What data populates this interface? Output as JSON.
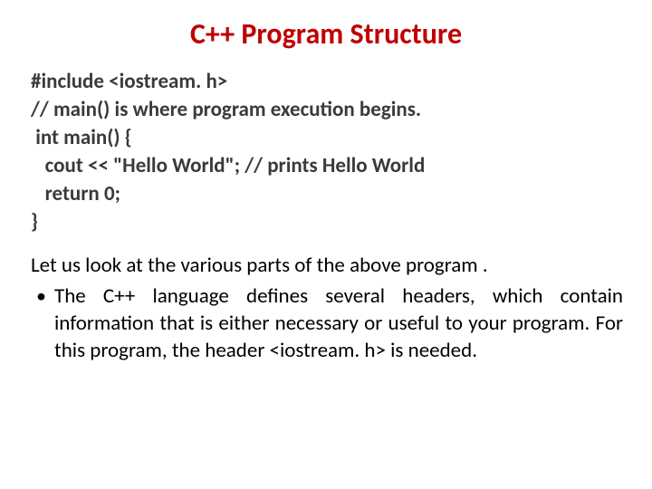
{
  "title": "C++ Program Structure",
  "code": {
    "l1": "#include <iostream. h>",
    "l2": "// main() is where program execution begins.",
    "l3": " int main() {",
    "l4": "   cout << \"Hello World\"; // prints Hello World",
    "l5": "   return 0;",
    "l6": "}"
  },
  "explain": {
    "intro": "Let us look at the various parts of the above program .",
    "bullet1": "The C++ language defines several headers, which contain information that is either necessary or useful to your program. For this program, the header <iostream. h> is needed."
  }
}
